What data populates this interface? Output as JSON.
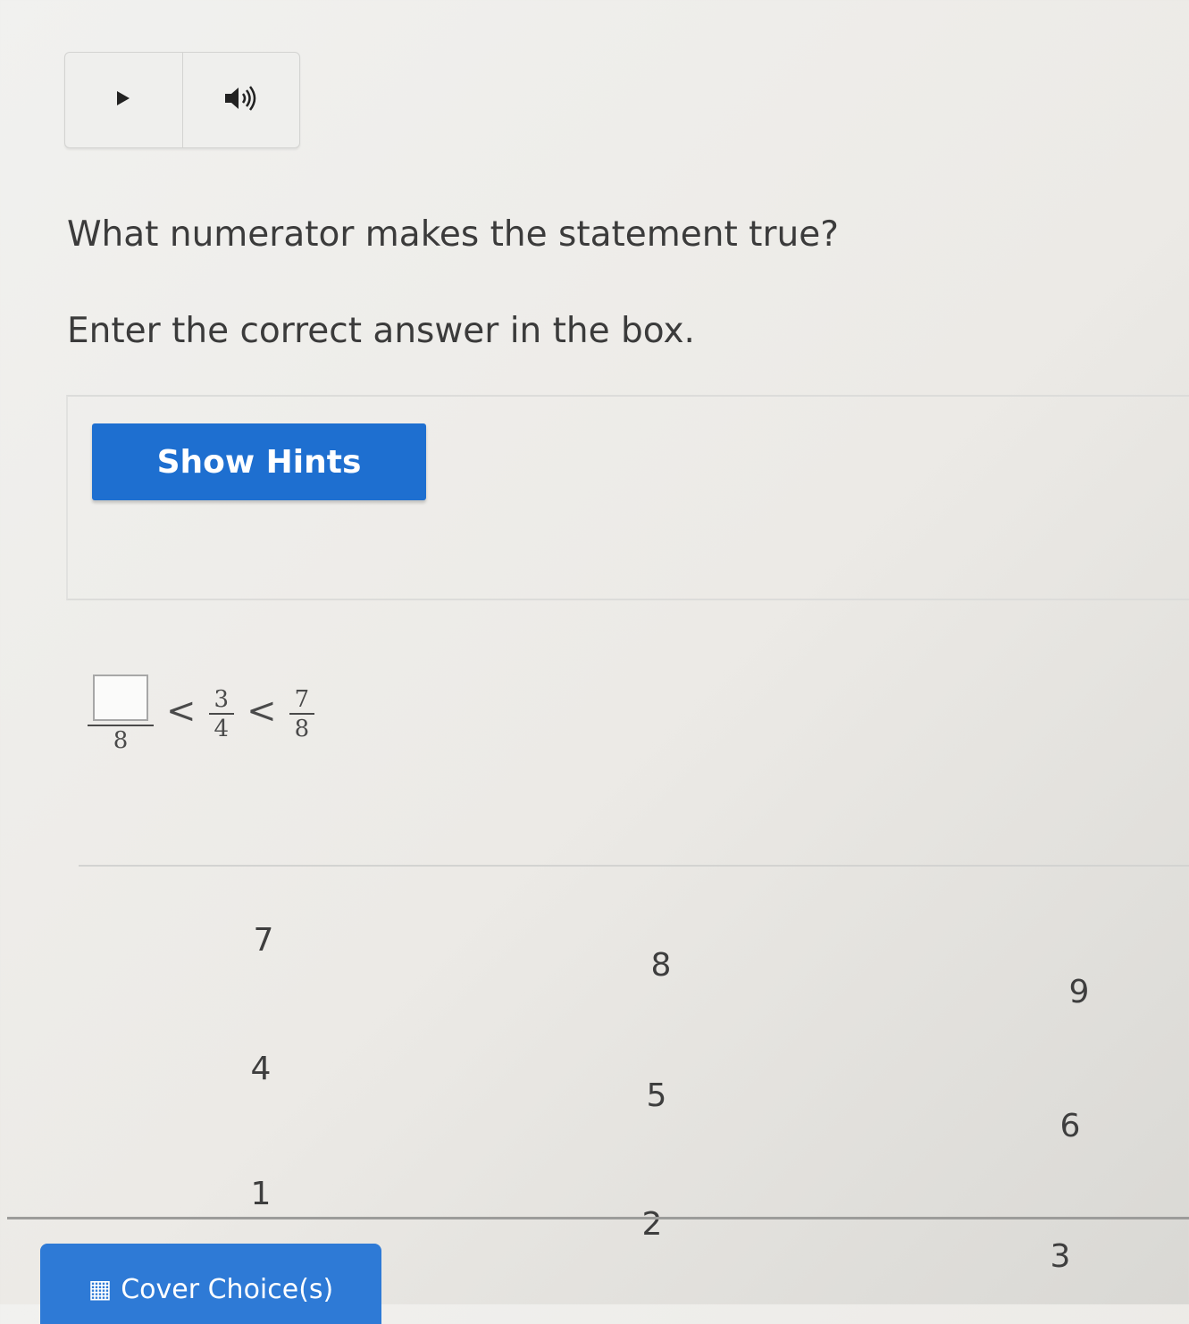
{
  "audio": {
    "play_icon": "play-icon",
    "volume_icon": "volume-icon"
  },
  "question": {
    "prompt": "What numerator makes the statement true?",
    "instruction": "Enter the correct answer in the box."
  },
  "hints": {
    "button_label": "Show Hints"
  },
  "statement": {
    "answer_value": "",
    "denominator": "8",
    "operator": "<",
    "frac2": {
      "num": "3",
      "den": "4"
    },
    "frac3": {
      "num": "7",
      "den": "8"
    }
  },
  "choices": [
    "7",
    "8",
    "9",
    "4",
    "5",
    "6",
    "1",
    "2",
    "3"
  ],
  "cover": {
    "label": "Cover Choice(s)",
    "icon": "cover-icon"
  },
  "colors": {
    "primary": "#1e6fd0",
    "cover": "#2e7ad6"
  }
}
